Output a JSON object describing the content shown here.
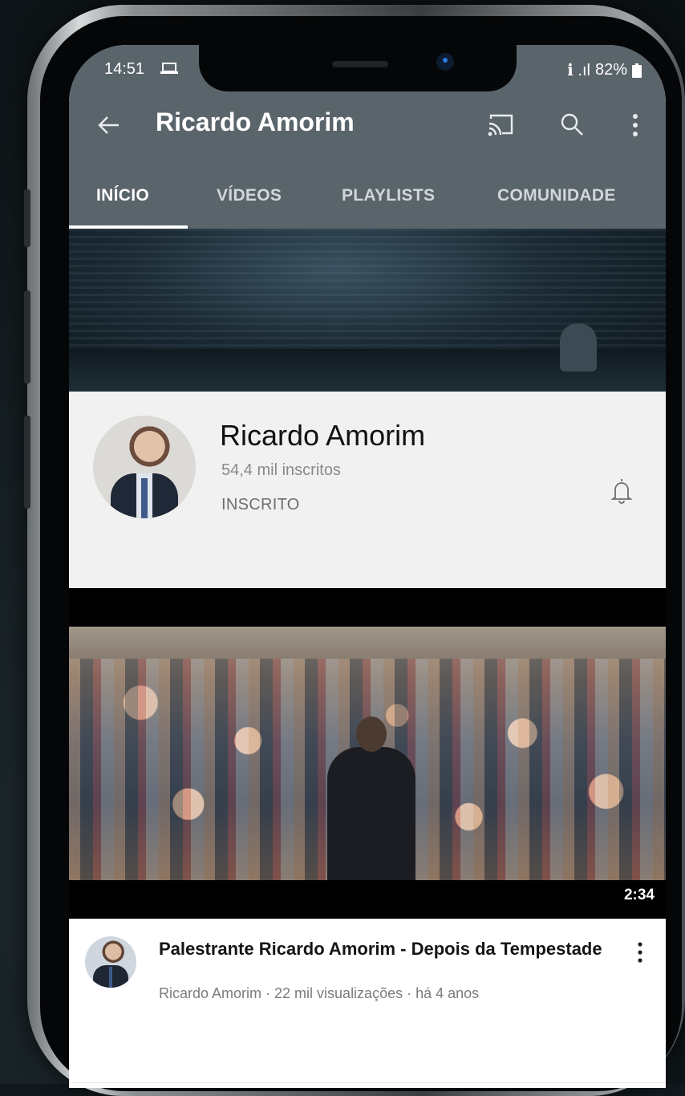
{
  "status_bar": {
    "time": "14:51",
    "battery": "82%",
    "signal": "ℹ .ıl"
  },
  "toolbar": {
    "title": "Ricardo Amorim"
  },
  "tabs": [
    {
      "label": "INÍCIO",
      "active": true
    },
    {
      "label": "VÍDEOS",
      "active": false
    },
    {
      "label": "PLAYLISTS",
      "active": false
    },
    {
      "label": "COMUNIDADE",
      "active": false
    }
  ],
  "channel": {
    "name": "Ricardo Amorim",
    "subscribers": "54,4 mil inscritos",
    "subscribe_state": "INSCRITO"
  },
  "featured_video": {
    "duration": "2:34",
    "title": "Palestrante Ricardo Amorim - Depois da Tempestade",
    "subtitle": "Ricardo Amorim · 22 mil visualizações · há 4 anos"
  },
  "colors": {
    "appbar": "#5a646b",
    "channel_bg": "#f1f1f1",
    "background": "#11191d"
  }
}
